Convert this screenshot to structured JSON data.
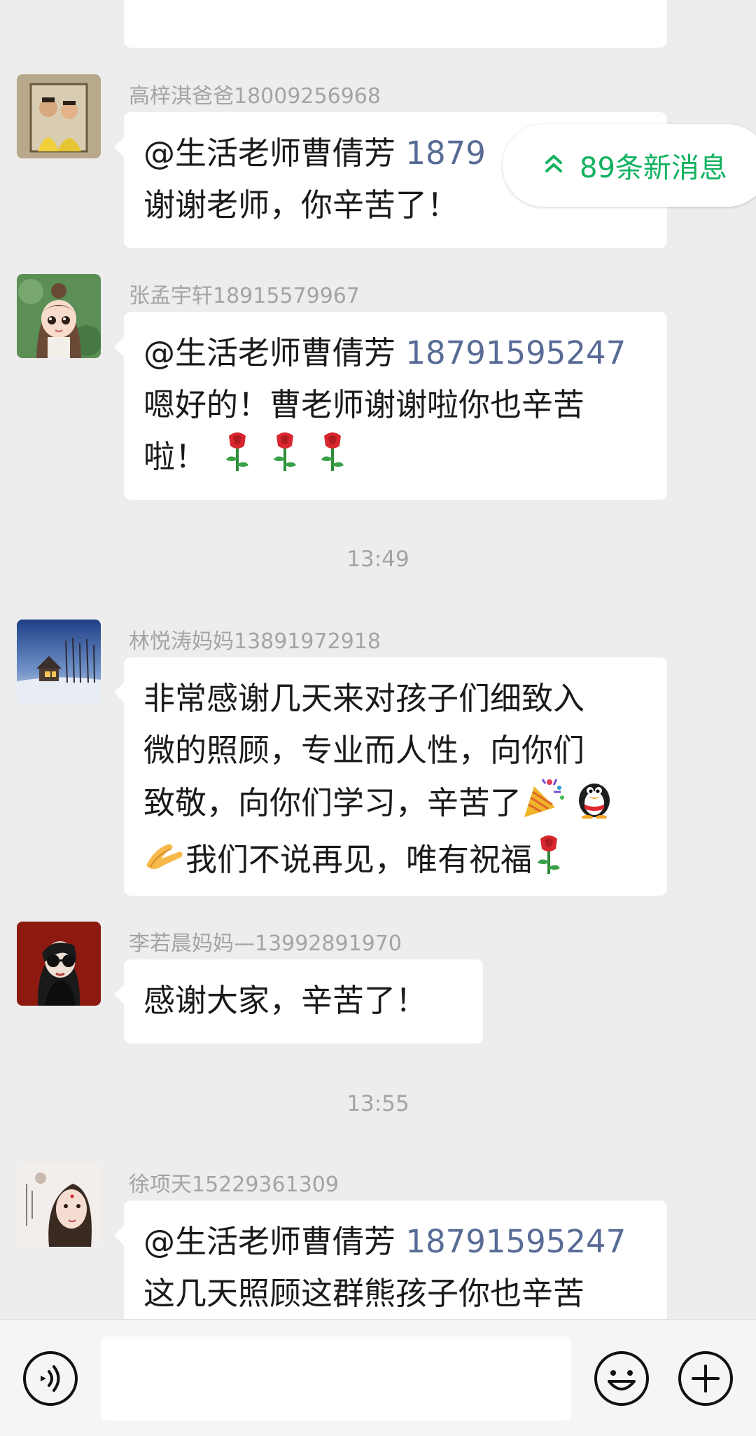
{
  "messages": [
    {
      "sender": "高梓淇爸爸18009256968",
      "mention_prefix": "@生活老师曹倩芳 ",
      "mention_number": "1879",
      "lines": [
        "谢谢老师，你辛苦了！"
      ]
    },
    {
      "sender": "张孟宇轩18915579967",
      "mention_prefix": "@生活老师曹倩芳 ",
      "mention_number": "18791595247",
      "lines": [
        "嗯好的！曹老师谢谢啦你也辛苦",
        "啦！"
      ],
      "trailing_emoji": [
        "rose-emoji",
        "rose-emoji",
        "rose-emoji"
      ]
    },
    {
      "sender": "林悦涛妈妈13891972918",
      "lines": [
        "非常感谢几天来对孩子们细致入",
        "微的照顾，专业而人性，向你们",
        "致敬，向你们学习，辛苦了",
        "我们不说再见，唯有祝福"
      ],
      "line3_emoji": [
        "party-popper-emoji",
        "penguin-emoji"
      ],
      "line4_lead_emoji": "clapping-hand-emoji",
      "line4_trail_emoji": "rose-emoji"
    },
    {
      "sender": "李若晨妈妈—13992891970",
      "lines": [
        "感谢大家，辛苦了！"
      ]
    },
    {
      "sender": "徐项天15229361309",
      "mention_prefix": "@生活老师曹倩芳 ",
      "mention_number": "18791595247",
      "lines": [
        "这几天照顾这群熊孩子你也辛苦"
      ]
    }
  ],
  "timestamps": [
    "13:49",
    "13:55"
  ],
  "new_messages_pill": {
    "label": "89条新消息",
    "icon": "double-chevron-up-icon",
    "color": "#12b160"
  },
  "input_bar": {
    "placeholder": "",
    "icons": [
      "voice-icon",
      "emoji-face-icon",
      "plus-circle-icon"
    ]
  },
  "colors": {
    "background": "#ededed",
    "bubble": "#ffffff",
    "mention_number": "#576b95",
    "sender_name": "#a4a4a4",
    "accent_green": "#12b160"
  }
}
